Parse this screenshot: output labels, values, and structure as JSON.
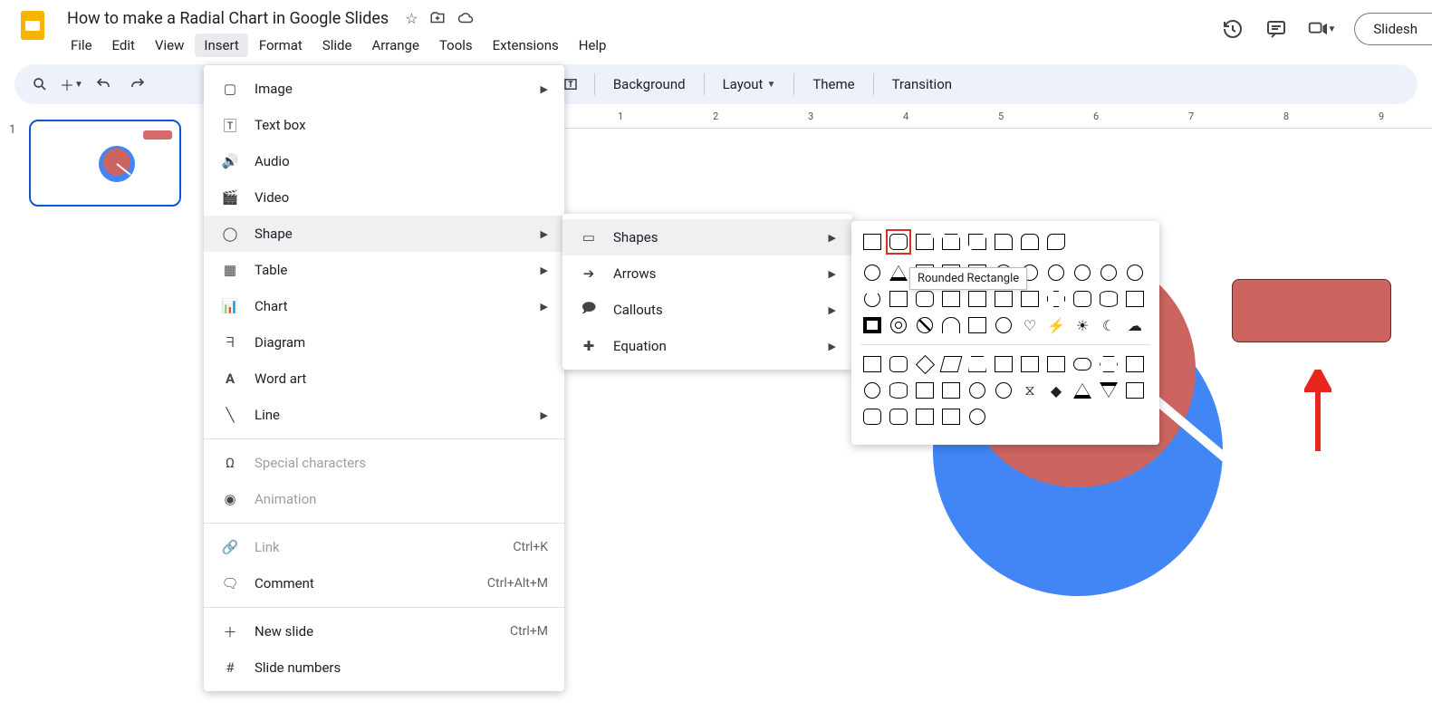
{
  "doc": {
    "title": "How to make a Radial Chart in Google Slides"
  },
  "menubar": [
    "File",
    "Edit",
    "View",
    "Insert",
    "Format",
    "Slide",
    "Arrange",
    "Tools",
    "Extensions",
    "Help"
  ],
  "menubar_active_index": 3,
  "header_actions": {
    "slideshow": "Slidesh"
  },
  "toolbar": {
    "background": "Background",
    "layout": "Layout",
    "theme": "Theme",
    "transition": "Transition"
  },
  "slide_panel": {
    "slides": [
      {
        "num": "1"
      }
    ]
  },
  "insert_menu": {
    "image": "Image",
    "textbox": "Text box",
    "audio": "Audio",
    "video": "Video",
    "shape": "Shape",
    "table": "Table",
    "chart": "Chart",
    "diagram": "Diagram",
    "wordart": "Word art",
    "line": "Line",
    "special": "Special characters",
    "animation": "Animation",
    "link": "Link",
    "link_sc": "Ctrl+K",
    "comment": "Comment",
    "comment_sc": "Ctrl+Alt+M",
    "newslide": "New slide",
    "newslide_sc": "Ctrl+M",
    "slidenums": "Slide numbers"
  },
  "shape_menu": {
    "shapes": "Shapes",
    "arrows": "Arrows",
    "callouts": "Callouts",
    "equation": "Equation"
  },
  "tooltip": "Rounded Rectangle",
  "ruler_marks": [
    "1",
    "2",
    "3",
    "4",
    "5",
    "6",
    "7",
    "8",
    "9"
  ]
}
